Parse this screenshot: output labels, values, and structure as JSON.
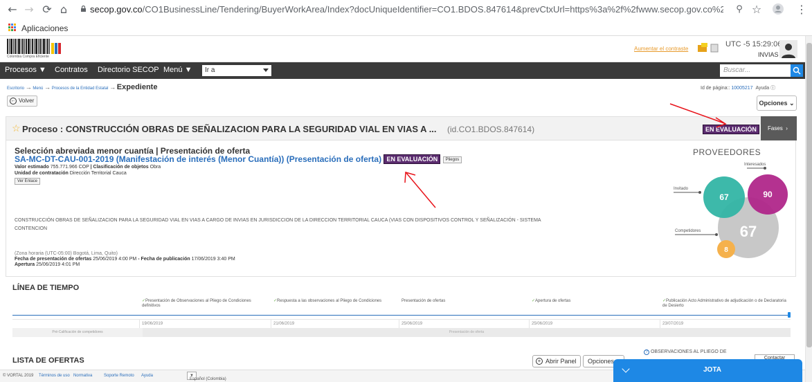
{
  "browser": {
    "url_host": "secop.gov.co",
    "url_path": "/CO1BusinessLine/Tendering/BuyerWorkArea/Index?docUniqueIdentifier=CO1.BDOS.847614&prevCtxUrl=https%3a%2f%2fwww.secop.gov.co%2fCO1Busi...",
    "bookmarks_label": "Aplicaciones"
  },
  "header": {
    "logo_sub": "Colombia Compra Eficiente",
    "contrast_link": "Aumentar el contraste",
    "utc": "UTC -5 15:29:06",
    "org": "INVIAS"
  },
  "nav": {
    "procesos": "Procesos",
    "contratos": "Contratos",
    "directorio": "Directorio SECOP",
    "menu": "Menú",
    "goto_value": "Ir a",
    "search_placeholder": "Buscar..."
  },
  "breadcrumb": {
    "escritorio": "Escritorio",
    "menu": "Menú",
    "procesos": "Procesos de la Entidad Estatal",
    "current": "Expediente",
    "page_id_label": "Id de página::",
    "page_id": "10005217",
    "ayuda": "Ayuda"
  },
  "actions": {
    "volver": "Volver",
    "opciones": "Opciones"
  },
  "proceso": {
    "title": "Proceso : CONSTRUCCIÓN OBRAS DE SEÑALIZACION PARA LA SEGURIDAD VIAL EN VIAS A ...",
    "id": "(id.CO1.BDOS.847614)",
    "status": "EN EVALUACIÓN",
    "fases": "Fases"
  },
  "detail": {
    "modality": "Selección abreviada menor cuantía | Presentación de oferta",
    "reference": "SA-MC-DT-CAU-001-2019 (Manifestación de interés (Menor Cuantía)) (Presentación de oferta)",
    "status": "EN EVALUACIÓN",
    "pliegos": "Pliegos",
    "valor_label": "Valor estimado",
    "valor": "755.771.966 COP",
    "clasif_label": "| Clasificación de objetos",
    "clasif": "Obra",
    "unidad_label": "Unidad de contratación",
    "unidad": "Dirección Territorial Cauca",
    "ver_enlace": "Ver Enlace",
    "description": "CONSTRUCCIÓN OBRAS DE SEÑALIZACION PARA LA SEGURIDAD VIAL EN VIAS A CARGO DE INVIAS EN JURISDICCION DE LA DIRECCION TERRITORIAL CAUCA (VIAS CON DISPOSITIVOS CONTROL Y SEÑALIZACIÓN - SISTEMA CONTENCION",
    "timezone": "(Zona horaria (UTC-05:00) Bogotá, Lima, Quito)",
    "fecha_pres_label": "Fecha de presentación de ofertas",
    "fecha_pres": "25/06/2019 4:00 PM",
    "fecha_pub_label": "- Fecha de publicación",
    "fecha_pub": "17/06/2019 3:40 PM",
    "apertura_label": "Apertura",
    "apertura": "25/06/2019 4:01 PM"
  },
  "proveedores": {
    "title": "PROVEEDORES",
    "interesados_label": "Interesados",
    "invitado_label": "Invitado",
    "competidores_label": "Competidores",
    "interesados": "90",
    "invitados": "67",
    "competidores": "8",
    "total": "67",
    "colors": {
      "invitado": "#33b5a5",
      "interesados": "#b0278a",
      "competidores": "#f5b14c",
      "total": "#c8c8c8"
    }
  },
  "timeline": {
    "title": "LÍNEA DE TIEMPO",
    "events": [
      {
        "label": "Presentación de Observaciones al Pliego de Condiciones definitivos",
        "date": "19/06/2019",
        "done": true
      },
      {
        "label": "Respuesta a las observaciones al Pliego de Condiciones",
        "date": "21/06/2019",
        "done": true
      },
      {
        "label": "Presentación de ofertas",
        "date": "25/06/2019",
        "done": false
      },
      {
        "label": "Apertura de ofertas",
        "date": "25/06/2019",
        "done": true
      },
      {
        "label": "Publicación Acto Administrativo de adjudicación o de Declaratoria de Desierto",
        "date": "23/07/2019",
        "done": true
      }
    ],
    "phase_pre": "Pré-Calificación de competidores",
    "phase_pres": "Presentación de oferta"
  },
  "ofertas": {
    "title": "LISTA DE OFERTAS",
    "abrir": "Abrir Panel",
    "opciones": "Opciones",
    "observaciones": "OBSERVACIONES AL PLIEGO DE",
    "contactar": "Contactar"
  },
  "footer": {
    "copyright": "© VORTAL 2019",
    "terminos": "Términos de uso",
    "normativa": "Normativa",
    "soporte": "Soporte Remoto",
    "ayuda": "Ayuda",
    "lang": "Español (Colombia)"
  },
  "chat": {
    "name": "JOTA"
  }
}
